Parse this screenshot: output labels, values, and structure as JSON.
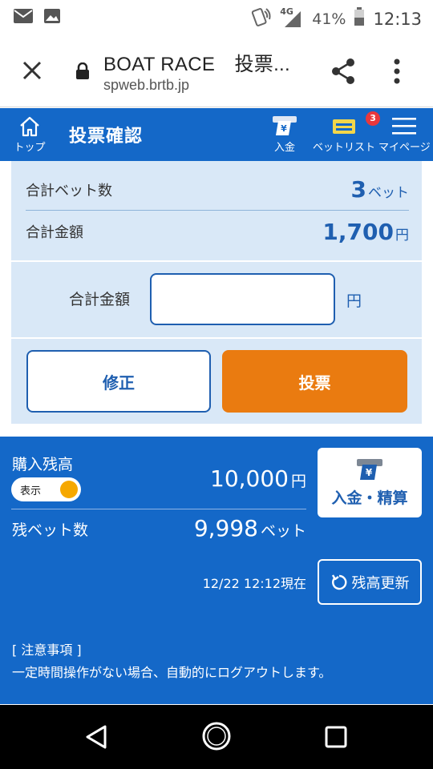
{
  "status_bar": {
    "network": "4G",
    "battery": "41%",
    "time": "12:13"
  },
  "browser": {
    "title": "BOAT RACE　投票...",
    "url": "spweb.brtb.jp"
  },
  "app_header": {
    "home_label": "トップ",
    "page_title": "投票確認",
    "deposit_label": "入金",
    "betlist_label": "ベットリスト",
    "betlist_badge": "3",
    "mypage_label": "マイページ"
  },
  "summary": {
    "total_bets_label": "合計ベット数",
    "total_bets_value": "3",
    "total_bets_unit": "ベット",
    "total_amount_label": "合計金額",
    "total_amount_value": "1,700",
    "total_amount_unit": "円"
  },
  "amount_input": {
    "label": "合計金額",
    "value": "",
    "unit": "円"
  },
  "actions": {
    "fix_label": "修正",
    "vote_label": "投票"
  },
  "balance": {
    "label": "購入残高",
    "toggle_label": "表示",
    "amount": "10,000",
    "amount_unit": "円",
    "deposit_button": "入金・精算",
    "remaining_bets_label": "残ベット数",
    "remaining_bets_value": "9,998",
    "remaining_bets_unit": "ベット",
    "updated_at": "12/22 12:12現在",
    "refresh_button": "残高更新"
  },
  "notice": {
    "title": "[ 注意事項 ]",
    "text": "一定時間操作がない場合、自動的にログアウトします。"
  },
  "colors": {
    "primary_blue": "#1468c8",
    "panel_bg": "#d9e8f7",
    "vote_orange": "#ea7b10",
    "badge_red": "#e8383d",
    "toggle_knob": "#f6a800"
  }
}
